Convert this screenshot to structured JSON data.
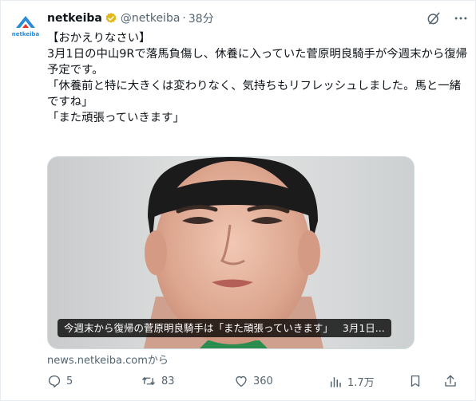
{
  "account": {
    "avatar_label": "netkeiba",
    "display_name": "netkeiba",
    "handle": "@netkeiba",
    "separator": "·",
    "time_ago": "38分"
  },
  "tweet": {
    "lines": [
      "【おかえりなさい】",
      "3月1日の中山9Rで落馬負傷し、休養に入っていた菅原明良騎手が今週末から復帰予定です。",
      "",
      "「休養前と特に大きくは変わりなく、気持ちもリフレッシュしました。馬と一緒ですね」",
      "「また頑張っていきます」"
    ]
  },
  "media": {
    "caption_title": "今週末から復帰の菅原明良騎手は「また頑張っていきます」",
    "caption_date": "3月1日..."
  },
  "source_text": "news.netkeiba.comから",
  "metrics": {
    "replies": "5",
    "reposts": "83",
    "likes": "360",
    "views": "1.7万"
  },
  "colors": {
    "text": "#0f1419",
    "muted": "#536471",
    "brand_blue": "#2a8bd8",
    "verified_gold": "#e2b719",
    "border": "#cfd9de"
  },
  "icons": [
    "netkeiba-logo-icon",
    "verified-badge-icon",
    "grok-icon",
    "more-icon",
    "reply-icon",
    "repost-icon",
    "like-icon",
    "views-icon",
    "bookmark-icon",
    "share-icon"
  ]
}
